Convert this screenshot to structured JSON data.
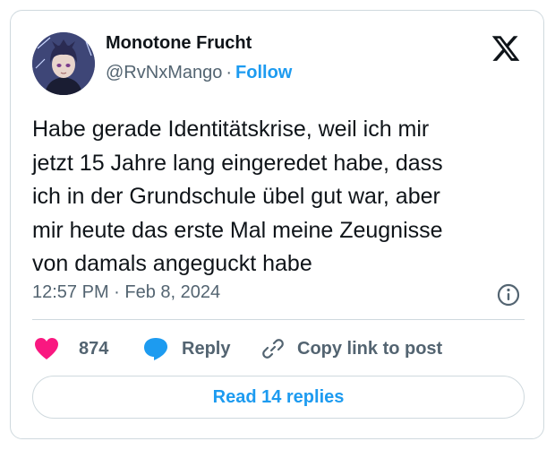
{
  "author": {
    "display_name": "Monotone Frucht",
    "handle": "@RvNxMango",
    "separator": "·",
    "follow_label": "Follow"
  },
  "tweet": {
    "text": "Habe gerade Identitätskrise, weil ich mir\njetzt 15 Jahre lang eingeredet habe, dass\nich in der Grundschule übel gut war, aber\nmir heute das erste Mal meine Zeugnisse\nvon damals angeguckt habe",
    "timestamp": "12:57 PM · Feb 8, 2024"
  },
  "actions": {
    "like_count": "874",
    "reply_label": "Reply",
    "copy_link_label": "Copy link to post"
  },
  "footer": {
    "read_replies_label": "Read 14 replies"
  },
  "icons": {
    "logo": "x-logo-icon",
    "info": "info-icon",
    "like": "heart-icon",
    "reply": "speech-bubble-icon",
    "copy": "link-icon"
  },
  "colors": {
    "accent": "#1d9bf0",
    "heart": "#f91880",
    "text_primary": "#0f1419",
    "text_secondary": "#536471",
    "border": "#cfd9de"
  }
}
